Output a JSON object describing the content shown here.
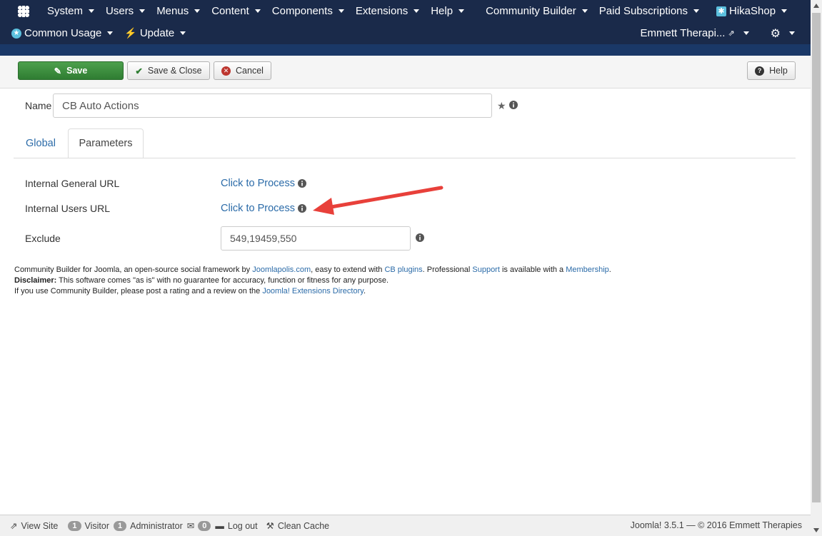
{
  "navbar": {
    "row1": [
      {
        "label": "System",
        "name": "menu-system"
      },
      {
        "label": "Users",
        "name": "menu-users"
      },
      {
        "label": "Menus",
        "name": "menu-menus"
      },
      {
        "label": "Content",
        "name": "menu-content"
      },
      {
        "label": "Components",
        "name": "menu-components"
      },
      {
        "label": "Extensions",
        "name": "menu-extensions"
      },
      {
        "label": "Help",
        "name": "menu-help"
      },
      {
        "label": "Community Builder",
        "name": "menu-community-builder"
      },
      {
        "label": "Paid Subscriptions",
        "name": "menu-paid-subscriptions"
      },
      {
        "label": "HikaShop",
        "name": "menu-hikashop"
      }
    ],
    "common_usage": "Common Usage",
    "update": "Update",
    "site_name": "Emmett Therapi..."
  },
  "toolbar": {
    "save": "Save",
    "save_close": "Save & Close",
    "cancel": "Cancel",
    "help": "Help"
  },
  "form": {
    "name_label": "Name",
    "name_value": "CB Auto Actions"
  },
  "tabs": {
    "global": "Global",
    "parameters": "Parameters"
  },
  "params": {
    "internal_general_url_label": "Internal General URL",
    "internal_general_url_link": "Click to Process",
    "internal_users_url_label": "Internal Users URL",
    "internal_users_url_link": "Click to Process",
    "exclude_label": "Exclude",
    "exclude_value": "549,19459,550"
  },
  "footer": {
    "line1_a": "Community Builder for Joomla, an open-source social framework by ",
    "joomlapolis": "Joomlapolis.com",
    "line1_b": ", easy to extend with ",
    "cb_plugins": "CB plugins",
    "line1_c": ". Professional ",
    "support": "Support",
    "line1_d": " is available with a ",
    "membership": "Membership",
    "line1_e": ".",
    "disclaimer_label": "Disclaimer:",
    "disclaimer_text": " This software comes \"as is\" with no guarantee for accuracy, function or fitness for any purpose.",
    "line3_a": "If you use Community Builder, please post a rating and a review on the ",
    "jed": "Joomla! Extensions Directory",
    "line3_b": "."
  },
  "statusbar": {
    "view_site": "View Site",
    "visitor_count": "1",
    "visitor": "Visitor",
    "admin_count": "1",
    "administrator": "Administrator",
    "messages_count": "0",
    "logout": "Log out",
    "clean_cache": "Clean Cache",
    "version": "Joomla! 3.5.1  —  © 2016 Emmett Therapies"
  },
  "colors": {
    "navbar": "#1a2a4a",
    "save_green": "#2f7d32",
    "link_blue": "#2b6ba8",
    "arrow_red": "#e8403a"
  }
}
